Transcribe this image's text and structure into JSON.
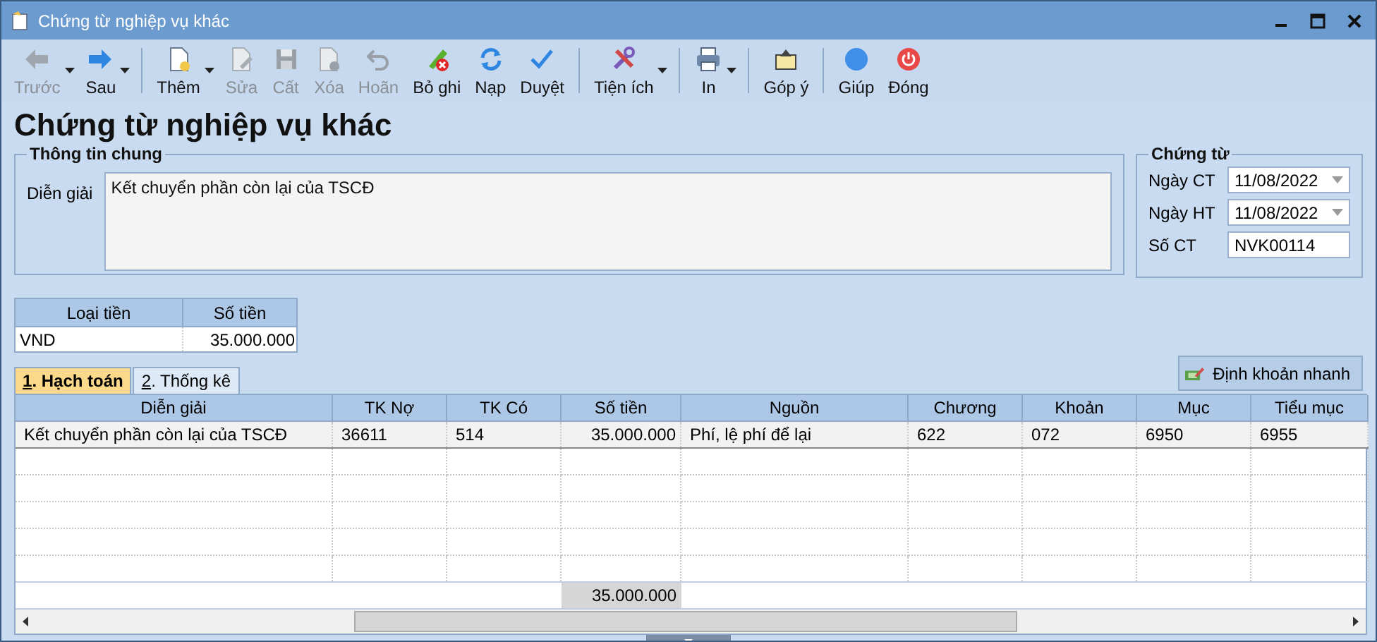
{
  "window": {
    "title": "Chứng từ nghiệp vụ khác"
  },
  "toolbar": [
    {
      "label": "Trước",
      "disabled": true,
      "dropdown": true
    },
    {
      "label": "Sau",
      "disabled": false,
      "dropdown": true
    },
    {
      "label": "Thêm",
      "disabled": false,
      "dropdown": true
    },
    {
      "label": "Sửa",
      "disabled": true,
      "dropdown": false
    },
    {
      "label": "Cất",
      "disabled": true,
      "dropdown": false
    },
    {
      "label": "Xóa",
      "disabled": true,
      "dropdown": false
    },
    {
      "label": "Hoãn",
      "disabled": true,
      "dropdown": false
    },
    {
      "label": "Bỏ ghi",
      "disabled": false,
      "dropdown": false
    },
    {
      "label": "Nạp",
      "disabled": false,
      "dropdown": false
    },
    {
      "label": "Duyệt",
      "disabled": false,
      "dropdown": false
    },
    {
      "label": "Tiện ích",
      "disabled": false,
      "dropdown": true
    },
    {
      "label": "In",
      "disabled": false,
      "dropdown": true
    },
    {
      "label": "Góp ý",
      "disabled": false,
      "dropdown": false
    },
    {
      "label": "Giúp",
      "disabled": false,
      "dropdown": false
    },
    {
      "label": "Đóng",
      "disabled": false,
      "dropdown": false
    }
  ],
  "heading": "Chứng từ nghiệp vụ khác",
  "general": {
    "title": "Thông tin chung",
    "label": "Diễn giải",
    "value": "Kết chuyển phần còn lại của TSCĐ"
  },
  "voucher": {
    "title": "Chứng từ",
    "fields": [
      {
        "label": "Ngày CT",
        "value": "11/08/2022",
        "kind": "date"
      },
      {
        "label": "Ngày HT",
        "value": "11/08/2022",
        "kind": "date"
      },
      {
        "label": "Số CT",
        "value": "NVK00114",
        "kind": "text"
      }
    ]
  },
  "currency": {
    "columns": [
      "Loại tiền",
      "Số tiền"
    ],
    "rows": [
      [
        "VND",
        "35.000.000"
      ]
    ]
  },
  "tabs": [
    {
      "key": "1",
      "label": ". Hạch toán",
      "selected": true
    },
    {
      "key": "2",
      "label": ". Thống kê",
      "selected": false
    }
  ],
  "quick_button": "Định khoản nhanh",
  "grid": {
    "columns": [
      "Diễn giải",
      "TK Nợ",
      "TK Có",
      "Số tiền",
      "Nguồn",
      "Chương",
      "Khoản",
      "Mục",
      "Tiểu mục"
    ],
    "rows": [
      [
        "Kết chuyển phần còn lại của TSCĐ",
        "36611",
        "514",
        "35.000.000",
        "Phí, lệ phí để lại",
        "622",
        "072",
        "6950",
        "6955"
      ]
    ],
    "total": "35.000.000"
  }
}
